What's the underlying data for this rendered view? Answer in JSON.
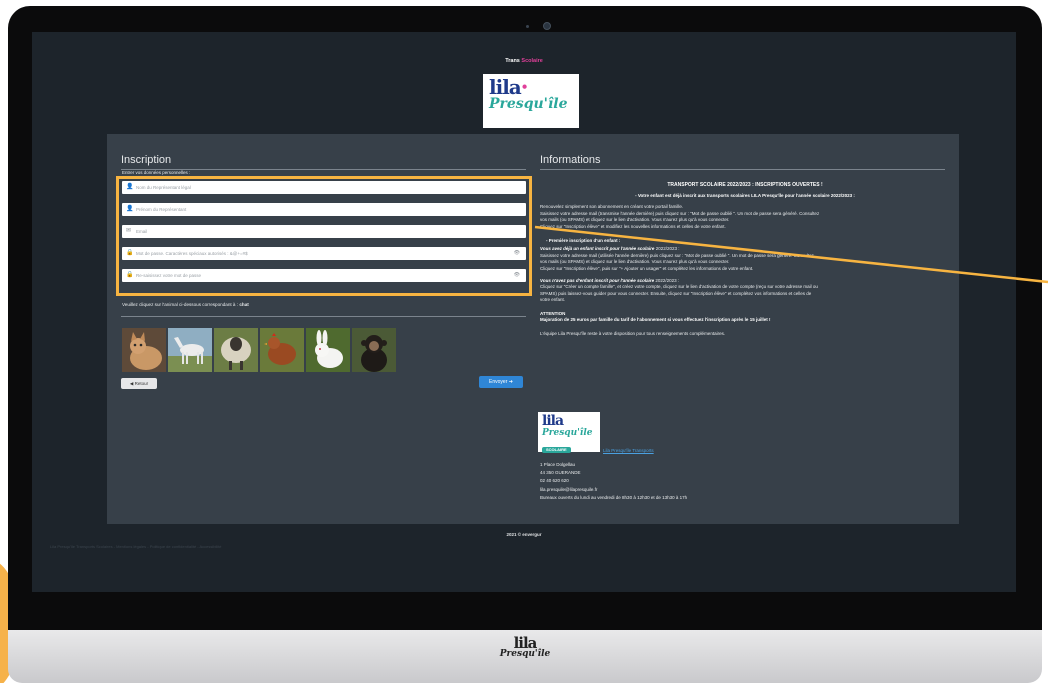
{
  "brand": {
    "trans_part1": "Trans",
    "trans_part2": "Scolaire",
    "logo_lila": "lila",
    "logo_presquile": "Presqu'île",
    "chin_lila": "lila",
    "chin_presquile": "Presqu'île",
    "accent_pink": "#e0409a",
    "accent_teal": "#2aa79b",
    "accent_navy": "#1f3a8a",
    "highlight_color": "#f7b441"
  },
  "inscription": {
    "title": "Inscription",
    "subtitle": "Entrer vos données personnelles :",
    "fields": [
      {
        "icon": "user-icon",
        "placeholder": "Nom du Représentant légal"
      },
      {
        "icon": "user-icon",
        "placeholder": "Prénom du Représentant"
      },
      {
        "icon": "envelope-icon",
        "placeholder": "Email"
      },
      {
        "icon": "lock-icon",
        "placeholder": "Mot de passe. Caractères spéciaux autorisés : &@+=#$"
      },
      {
        "icon": "lock-icon",
        "placeholder": "Re-saisissez votre mot de passe"
      }
    ],
    "captcha_prompt": "Veuillez cliquez sur l'animal ci-dessous correspondant à :",
    "captcha_answer": "chat",
    "animals": [
      "cat",
      "horse",
      "sheep",
      "hen",
      "rabbit",
      "chimpanzee"
    ],
    "back_label": "Retour",
    "send_label": "Envoyer"
  },
  "informations": {
    "title": "Informations",
    "heading": "TRANSPORT SCOLAIRE 2022/2023 : INSCRIPTIONS OUVERTES !",
    "section1_title": "- Votre enfant est déjà inscrit aux transports scolaires LILA Presqu'île pour l'année scolaire 2022/2023 :",
    "section1_lines": [
      "Renouvelez simplement son abonnement en créant votre portail famille.",
      "Saisissez votre adresse mail (transmise l'année dernière) puis cliquez sur : \"Mot de passe oublié \". Un mot de passe sera généré. Consultez",
      "vos mails (ou SPAMS) et cliquez sur le lien d'activation. Vous n'aurez plus qu'à vous connecter.",
      "Cliquez sur \"Inscription élève\" et modifiez les nouvelles informations et celles de votre enfant."
    ],
    "section2_title": "- Première inscription d'un enfant :",
    "section2a_lead": "Vous avez déjà un enfant inscrit pour l'année scolaire",
    "section2a_year": "2022/2023 :",
    "section2a_lines": [
      "Saisissez votre adresse mail (utilisée l'année dernière) puis cliquez sur : \"Mot de passe oublié \". Un mot de passe sera généré. Consultez",
      "vos mails (ou SPAMS) et cliquez sur le lien d'activation. Vous n'aurez plus qu'à vous connecter.",
      "Cliquez sur \"Inscription élève\", puis sur \"+ Ajouter un usager\" et complétez les informations de votre enfant."
    ],
    "section2b_lead": "Vous n'avez pas d'enfant inscrit pour l'année scolaire",
    "section2b_year": "2022/2023 :",
    "section2b_lines": [
      "Cliquez sur \"Créer un compte famille\", et créez votre compte, cliquez sur le lien d'activation de votre compte (reçu sur votre adresse mail ou",
      "SPAMS) puis laissez-vous guider pour vous connecter. Ensuite, cliquez sur \"Inscription élève\" et complétez vos informations et celles de",
      "votre enfant."
    ],
    "attention_title": "ATTENTION",
    "attention_text": "Majoration de 25 euros par famille du tarif de l'abonnement si vous effectuez l'inscription après le 15 juillet !",
    "team_text": "L'équipe Lila Presqu'île reste à votre disposition pour tous renseignements complémentaires.",
    "logo_lila": "lila",
    "logo_presquile": "Presqu'île",
    "logo_badge": "SCOLAIRE",
    "address_link": "Lila Presqu'île Transports",
    "address_lines": [
      "1 Place Dolgellau",
      "44 350 GUERANDE",
      "02 40 620 620",
      "lila.presquile@lilapresquile.fr",
      "Bureaux ouverts du lundi au vendredi de 8h30 à 12h30 et de 13h30 à 17h"
    ]
  },
  "footer": {
    "copyright": "2021 © envergur",
    "faint_text": "Lila Presqu'île Transports Scolaires - Mentions légales - Politique de confidentialité - Accessibilité"
  }
}
